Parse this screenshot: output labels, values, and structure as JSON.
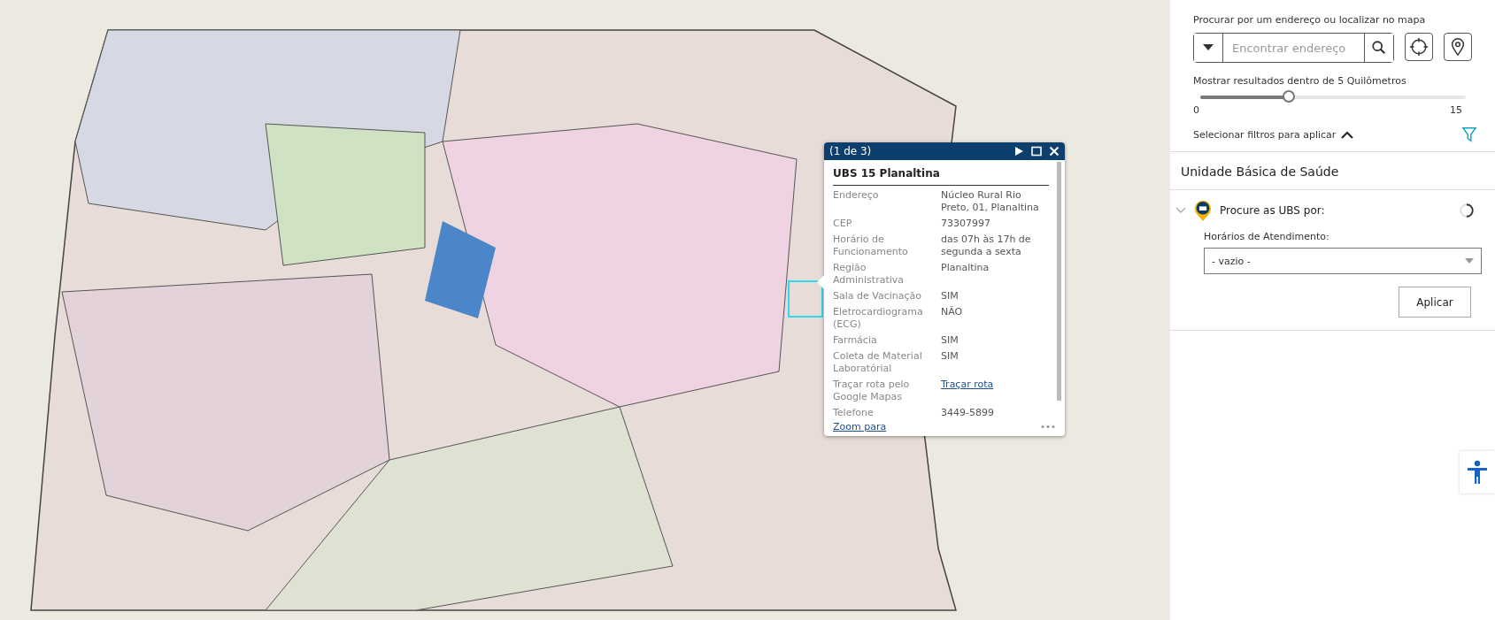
{
  "popup": {
    "counter": "(1 de 3)",
    "title": "UBS 15 Planaltina",
    "fields": [
      {
        "label": "Endereço",
        "value": "Núcleo Rural Rio Preto, 01, Planaltina",
        "kind": "text"
      },
      {
        "label": "CEP",
        "value": "73307997",
        "kind": "text"
      },
      {
        "label": "Horário de Funcionamento",
        "value": "das 07h às 17h de segunda a sexta",
        "kind": "text"
      },
      {
        "label": "Região Administrativa",
        "value": "Planaltina",
        "kind": "text"
      },
      {
        "label": "Sala de Vacinação",
        "value": "SIM",
        "kind": "text"
      },
      {
        "label": "Eletrocardiograma (ECG)",
        "value": "NÃO",
        "kind": "text"
      },
      {
        "label": "Farmácia",
        "value": "SIM",
        "kind": "text"
      },
      {
        "label": "Coleta de Material Laboratórial",
        "value": "SIM",
        "kind": "text"
      },
      {
        "label": "Traçar rota pelo Google Mapas",
        "value": "Traçar rota",
        "kind": "link"
      },
      {
        "label": "Telefone",
        "value": "3449-5899",
        "kind": "text"
      }
    ],
    "zoom_link": "Zoom para"
  },
  "search": {
    "heading": "Procurar por um endereço ou localizar no mapa",
    "placeholder": "Encontrar endereço",
    "radius_label": "Mostrar resultados dentro de 5 Quilômetros",
    "radius": {
      "level": 0.333,
      "min": "0",
      "max": "15"
    },
    "filters_label": "Selecionar filtros para aplicar",
    "filters_expanded": true
  },
  "layer": {
    "title": "Unidade Básica de Saúde",
    "filter_title": "Procure as UBS por:",
    "expanded": true,
    "field_label": "Horários de Atendimento:",
    "select_value": "- vazio -",
    "apply": "Aplicar"
  }
}
